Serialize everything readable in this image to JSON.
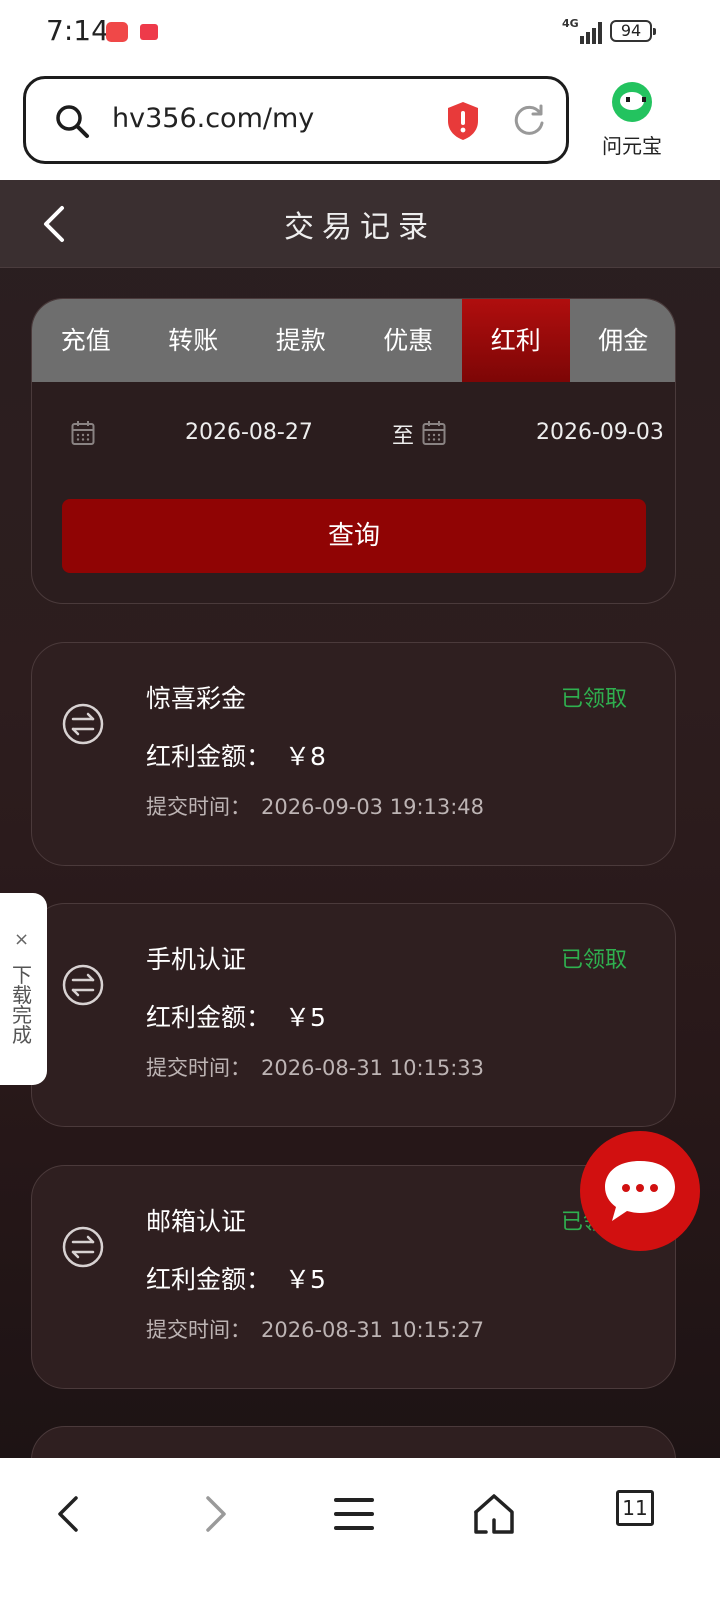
{
  "status_bar": {
    "time": "7:14",
    "network": "4G",
    "battery": "94"
  },
  "browser": {
    "url": "hv356.com/my",
    "ai_app_label": "问元宝",
    "tab_count": "11"
  },
  "header": {
    "title": "交易记录"
  },
  "tabs": [
    {
      "label": "充值",
      "active": false
    },
    {
      "label": "转账",
      "active": false
    },
    {
      "label": "提款",
      "active": false
    },
    {
      "label": "优惠",
      "active": false
    },
    {
      "label": "红利",
      "active": true
    },
    {
      "label": "佣金",
      "active": false
    }
  ],
  "date_filter": {
    "start": "2026-08-27",
    "separator": "至",
    "end": "2026-09-03"
  },
  "query_button": "查询",
  "records": [
    {
      "name": "惊喜彩金",
      "status": "已领取",
      "amount_label": "红利金额：",
      "amount": "￥8",
      "time_label": "提交时间：",
      "time": "2026-09-03 19:13:48"
    },
    {
      "name": "手机认证",
      "status": "已领取",
      "amount_label": "红利金额：",
      "amount": "￥5",
      "time_label": "提交时间：",
      "time": "2026-08-31 10:15:33"
    },
    {
      "name": "邮箱认证",
      "status": "已领取",
      "amount_label": "红利金额：",
      "amount": "￥5",
      "time_label": "提交时间：",
      "time": "2026-08-31 10:15:27"
    }
  ],
  "download_toast": {
    "close": "×",
    "text": "下载完成"
  },
  "colors": {
    "accent": "#900404",
    "active_tab": "#b00e0e",
    "status_green": "#2fb04f",
    "chat_bubble": "#d11010"
  },
  "icons": [
    "search-icon",
    "shield-icon",
    "reload-icon",
    "back-icon",
    "calendar-icon",
    "transfer-icon",
    "chat-icon",
    "forward-icon",
    "menu-icon",
    "home-icon"
  ]
}
